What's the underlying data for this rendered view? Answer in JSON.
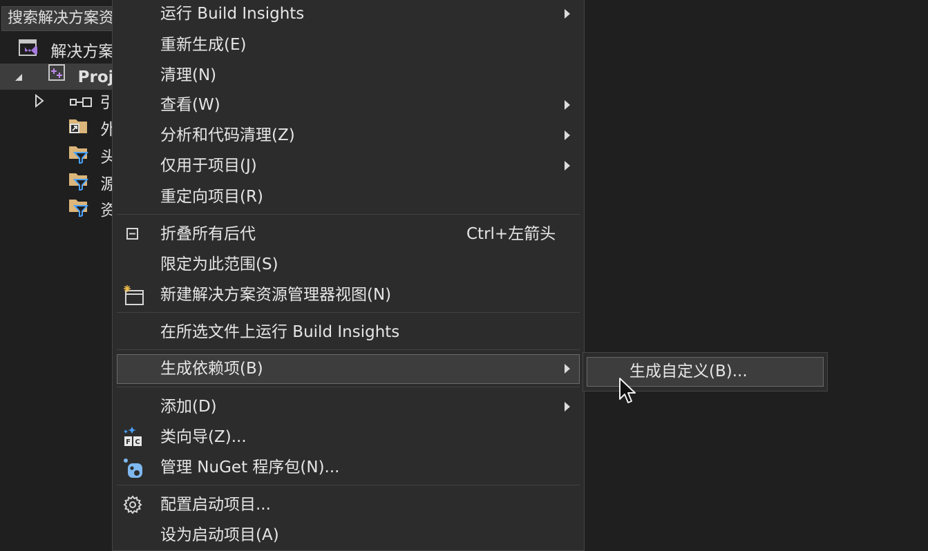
{
  "explorer": {
    "search_text": "搜索解决方案资",
    "solution_label": "解决方案",
    "project_label": "Proje",
    "tree": {
      "references": "引",
      "external": "外",
      "headers": "头",
      "sources": "源",
      "resources": "资"
    }
  },
  "menu": {
    "run_build_insights": "运行 Build Insights",
    "rebuild": "重新生成(E)",
    "clean": "清理(N)",
    "view": "查看(W)",
    "analyze": "分析和代码清理(Z)",
    "project_only": "仅用于项目(J)",
    "retarget": "重定向项目(R)",
    "collapse_all": "折叠所有后代",
    "collapse_all_shortcut": "Ctrl+左箭头",
    "scope_to_this": "限定为此范围(S)",
    "new_explorer_view": "新建解决方案资源管理器视图(N)",
    "run_build_insights_selected": "在所选文件上运行 Build Insights",
    "build_dependencies": "生成依赖项(B)",
    "add": "添加(D)",
    "class_wizard": "类向导(Z)...",
    "manage_nuget": "管理 NuGet 程序包(N)...",
    "configure_startup": "配置启动项目...",
    "set_as_startup": "设为启动项目(A)"
  },
  "submenu": {
    "build_customizations": "生成自定义(B)..."
  },
  "colors": {
    "menu_bg": "#2c2c2c",
    "highlight_bg": "#3d3d3d",
    "highlight_border": "#6a6a6a",
    "vs_purple": "#a67ae0",
    "folder_yellow": "#dcb67a",
    "filter_blue": "#4aa3ff"
  }
}
